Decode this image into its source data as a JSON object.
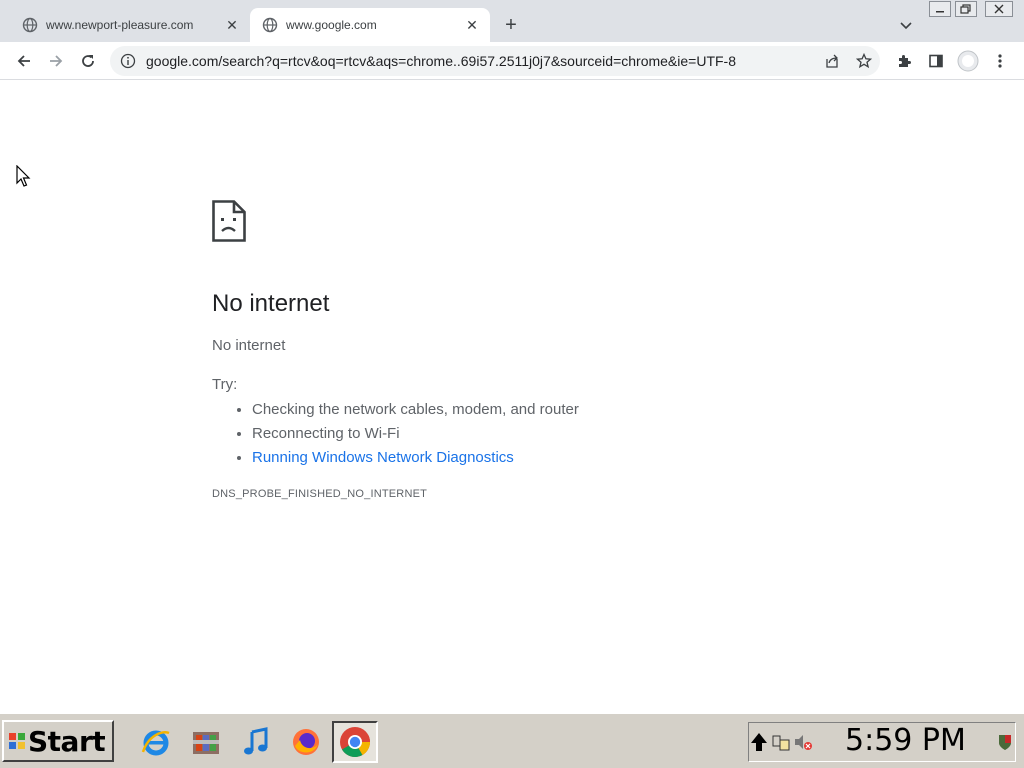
{
  "browser": {
    "tabs": [
      {
        "title": "www.newport-pleasure.com",
        "active": false
      },
      {
        "title": "www.google.com",
        "active": true
      }
    ],
    "address_bar": {
      "url": "google.com/search?q=rtcv&oq=rtcv&aqs=chrome..69i57.2511j0j7&sourceid=chrome&ie=UTF-8"
    }
  },
  "page": {
    "heading": "No internet",
    "subtitle": "No internet",
    "try_label": "Try:",
    "suggestions": [
      {
        "text": "Checking the network cables, modem, and router",
        "link": false
      },
      {
        "text": "Reconnecting to Wi-Fi",
        "link": false
      },
      {
        "text": "Running Windows Network Diagnostics",
        "link": true
      }
    ],
    "error_code": "DNS_PROBE_FINISHED_NO_INTERNET"
  },
  "taskbar": {
    "start_label": "Start",
    "apps": [
      "internet-explorer-icon",
      "archive-icon",
      "music-note-icon",
      "firefox-icon",
      "chrome-icon"
    ],
    "active_app": "chrome-icon",
    "clock": "5:59 PM"
  },
  "colors": {
    "link": "#1a73e8",
    "tabstrip": "#dee1e6",
    "taskbar": "#d4d0c8"
  }
}
